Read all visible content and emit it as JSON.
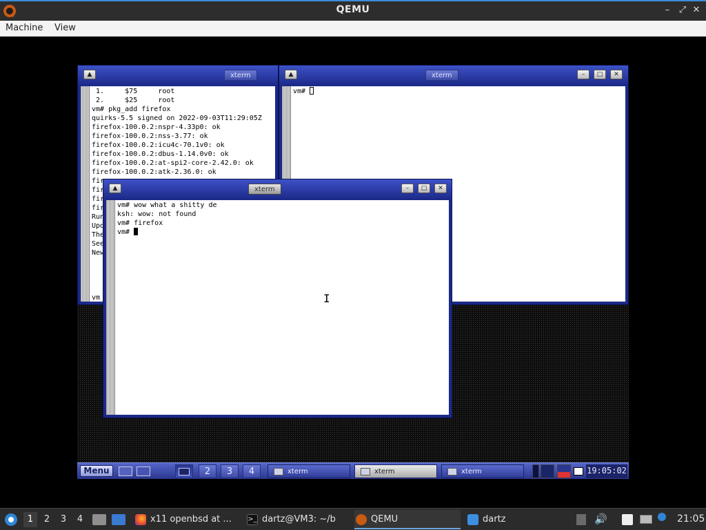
{
  "host": {
    "window_title": "QEMU",
    "menu": [
      "Machine",
      "View"
    ],
    "controls": {
      "minimize": "–",
      "restore": "⤢",
      "close": "✕"
    }
  },
  "vm": {
    "windows": [
      {
        "title": "xterm",
        "lines": [
          " 1.     $75     root",
          " 2.     $25     root",
          "vm# pkg_add firefox",
          "quirks-5.5 signed on 2022-09-03T11:29:05Z",
          "firefox-100.0.2:nspr-4.33p0: ok",
          "firefox-100.0.2:nss-3.77: ok",
          "firefox-100.0.2:icu4c-70.1v0: ok",
          "firefox-100.0.2:dbus-1.14.0v0: ok",
          "firefox-100.0.2:at-spi2-core-2.42.0: ok",
          "firefox-100.0.2:atk-2.36.0: ok",
          "fir",
          "fir",
          "fir",
          "fir",
          "Run",
          "Upd",
          "The",
          "See",
          "New",
          "",
          "",
          "",
          "",
          "vm"
        ]
      },
      {
        "title": "xterm",
        "prompt": "vm# "
      },
      {
        "title": "xterm",
        "lines": [
          "vm# wow what a shitty de",
          "ksh: wow: not found",
          "vm# firefox"
        ],
        "prompt": "vm# "
      }
    ],
    "panel": {
      "menu_label": "Menu",
      "workspaces": [
        "2",
        "3",
        "4"
      ],
      "tasks": [
        "xterm",
        "xterm",
        "xterm"
      ],
      "clock": "19:05:02"
    }
  },
  "taskbar": {
    "desktops": [
      "1",
      "2",
      "3",
      "4"
    ],
    "tasks": [
      {
        "label": "x11 openbsd at ...",
        "icon": "firefox-icon"
      },
      {
        "label": "dartz@VM3: ~/b",
        "icon": "terminal-icon"
      },
      {
        "label": "QEMU",
        "icon": "qemu-icon"
      },
      {
        "label": "dartz",
        "icon": "folder-icon"
      }
    ],
    "clock": "21:05"
  }
}
